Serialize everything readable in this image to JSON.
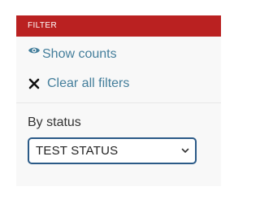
{
  "filter": {
    "header": "FILTER",
    "show_counts_label": "Show counts",
    "clear_all_label": "Clear all filters",
    "status_section_label": "By status",
    "status_select_value": "TEST STATUS"
  },
  "colors": {
    "header_bg": "#ba2121",
    "link": "#447e9b",
    "select_border": "#2b5a87"
  },
  "icons": {
    "show_counts": "eye-icon",
    "clear_all": "close-icon",
    "select": "chevron-down-icon"
  }
}
